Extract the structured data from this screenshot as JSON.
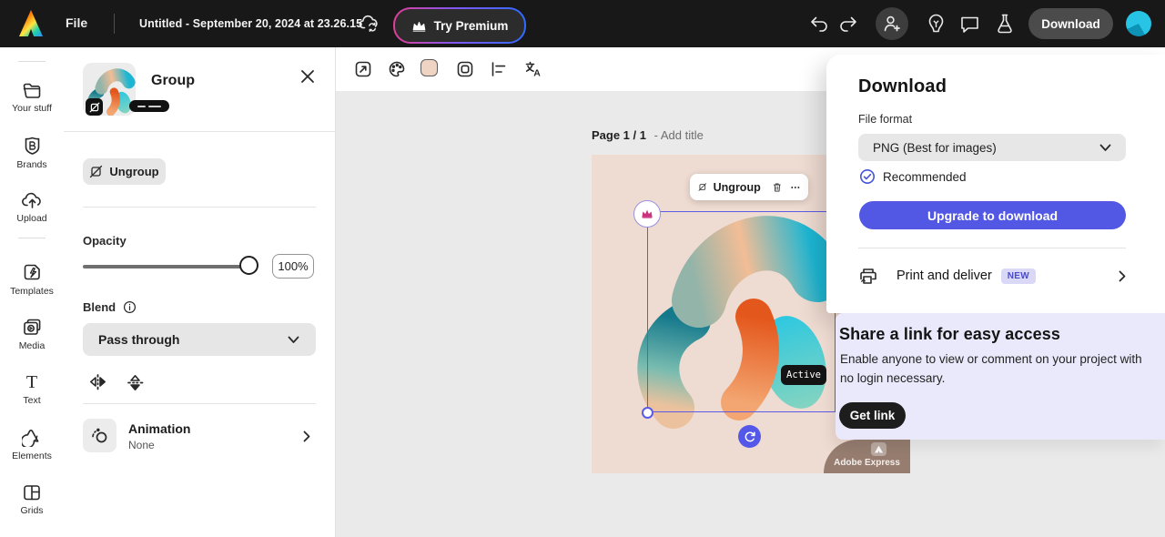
{
  "topbar": {
    "file_menu": "File",
    "title": "Untitled - September 20, 2024 at 23.26.15",
    "try_premium_label": "Try Premium",
    "download_label": "Download",
    "icons": [
      "adobe-express-logo",
      "cloud-sync-icon",
      "crown-icon",
      "undo-icon",
      "redo-icon",
      "add-collaborator-icon",
      "lightbulb-icon",
      "comment-icon",
      "beaker-icon",
      "user-avatar"
    ]
  },
  "sidebar": {
    "items": [
      {
        "label": "Your stuff",
        "icon": "folder-icon"
      },
      {
        "label": "Brands",
        "icon": "brand-shield-icon"
      },
      {
        "label": "Upload",
        "icon": "cloud-upload-icon"
      },
      {
        "label": "Templates",
        "icon": "templates-icon"
      },
      {
        "label": "Media",
        "icon": "media-icon"
      },
      {
        "label": "Text",
        "icon": "text-icon"
      },
      {
        "label": "Elements",
        "icon": "elements-icon"
      },
      {
        "label": "Grids",
        "icon": "grids-icon"
      }
    ]
  },
  "group_panel": {
    "title": "Group",
    "ungroup_label": "Ungroup",
    "opacity_label": "Opacity",
    "opacity_value": "100%",
    "blend_label": "Blend",
    "blend_value": "Pass through",
    "animation_label": "Animation",
    "animation_value": "None"
  },
  "canvas": {
    "page_indicator": "Page 1 / 1",
    "add_title_label": "- Add title",
    "context_toolbar": {
      "ungroup_label": "Ungroup"
    },
    "active_badge": "Active",
    "watermark": "Adobe Express",
    "toolbar_icons": [
      "resize-icon",
      "palette-icon",
      "background-color-swatch",
      "frame-icon",
      "align-icon",
      "translate-icon"
    ]
  },
  "download_panel": {
    "title": "Download",
    "file_format_label": "File format",
    "file_format_value": "PNG (Best for images)",
    "recommended_label": "Recommended",
    "upgrade_button": "Upgrade to download",
    "print_deliver_label": "Print and deliver",
    "new_badge": "NEW"
  },
  "share_promo": {
    "title": "Share a link for easy access",
    "body": "Enable anyone to view or comment on your project with no login necessary.",
    "get_link_button": "Get link"
  },
  "colors": {
    "accent": "#5258e4",
    "topbar_bg": "#181818",
    "canvas_page": "#eedbd1",
    "workspace_bg": "#eaeaea",
    "promo_bg": "#e9e9fb",
    "new_badge_bg": "#d9d9f7",
    "new_badge_text": "#4a4ace",
    "selection": "#5b5be6"
  }
}
